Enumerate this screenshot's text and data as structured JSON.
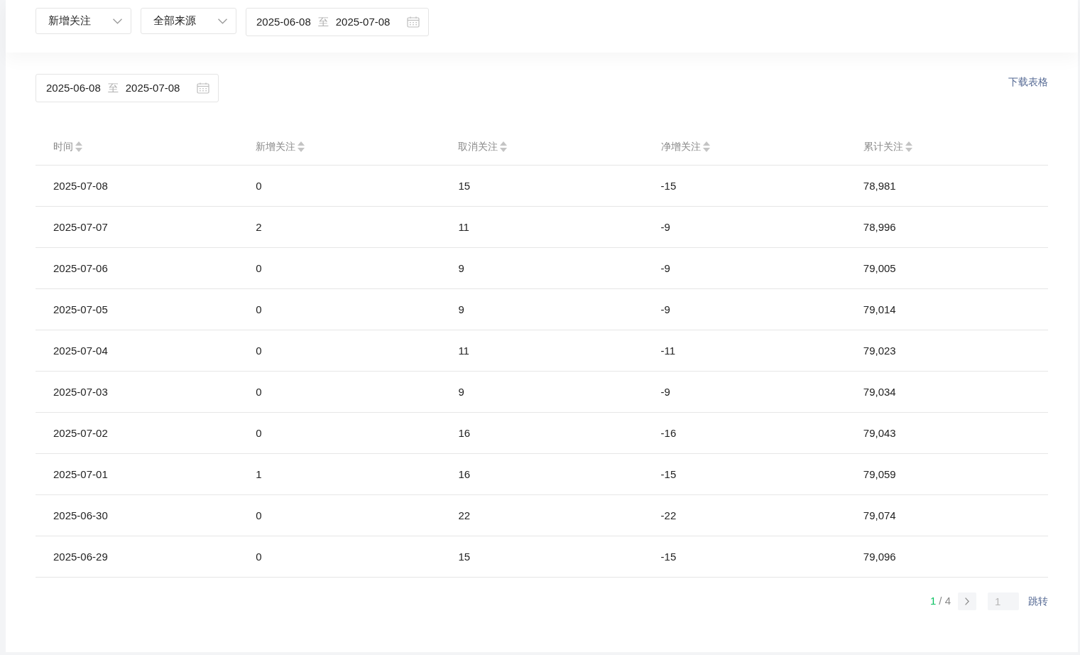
{
  "filters": {
    "metric": {
      "value": "新增关注"
    },
    "source": {
      "value": "全部来源"
    },
    "date_range": {
      "start": "2025-06-08",
      "separator": "至",
      "end": "2025-07-08"
    }
  },
  "table_section": {
    "date_range": {
      "start": "2025-06-08",
      "separator": "至",
      "end": "2025-07-08"
    },
    "download_link": "下载表格",
    "table": {
      "columns": [
        {
          "label": "时间"
        },
        {
          "label": "新增关注"
        },
        {
          "label": "取消关注"
        },
        {
          "label": "净增关注"
        },
        {
          "label": "累计关注"
        }
      ],
      "rows": [
        [
          "2025-07-08",
          "0",
          "15",
          "-15",
          "78,981"
        ],
        [
          "2025-07-07",
          "2",
          "11",
          "-9",
          "78,996"
        ],
        [
          "2025-07-06",
          "0",
          "9",
          "-9",
          "79,005"
        ],
        [
          "2025-07-05",
          "0",
          "9",
          "-9",
          "79,014"
        ],
        [
          "2025-07-04",
          "0",
          "11",
          "-11",
          "79,023"
        ],
        [
          "2025-07-03",
          "0",
          "9",
          "-9",
          "79,034"
        ],
        [
          "2025-07-02",
          "0",
          "16",
          "-16",
          "79,043"
        ],
        [
          "2025-07-01",
          "1",
          "16",
          "-15",
          "79,059"
        ],
        [
          "2025-06-30",
          "0",
          "22",
          "-22",
          "79,074"
        ],
        [
          "2025-06-29",
          "0",
          "15",
          "-15",
          "79,096"
        ]
      ]
    },
    "pagination": {
      "current": "1",
      "total": "/ 4",
      "jump_input": {
        "placeholder": "1"
      },
      "jump_button": "跳转"
    }
  }
}
